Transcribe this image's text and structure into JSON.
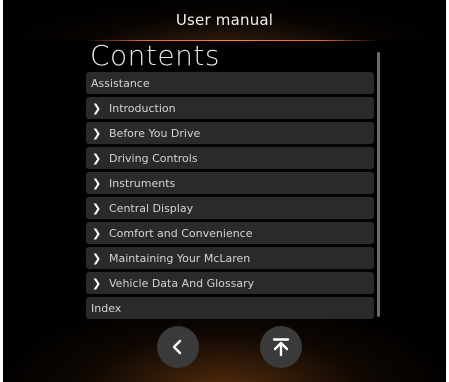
{
  "header": {
    "title": "User manual"
  },
  "contents": {
    "heading": "Contents",
    "items": [
      {
        "label": "Assistance",
        "expandable": false
      },
      {
        "label": "Introduction",
        "expandable": true
      },
      {
        "label": "Before You Drive",
        "expandable": true
      },
      {
        "label": "Driving Controls",
        "expandable": true
      },
      {
        "label": "Instruments",
        "expandable": true
      },
      {
        "label": "Central Display",
        "expandable": true
      },
      {
        "label": "Comfort and Convenience",
        "expandable": true
      },
      {
        "label": "Maintaining Your McLaren",
        "expandable": true
      },
      {
        "label": "Vehicle Data And Glossary",
        "expandable": true
      },
      {
        "label": "Index",
        "expandable": false
      }
    ]
  },
  "footer": {
    "back_icon": "chevron-left-icon",
    "top_icon": "scroll-to-top-icon"
  },
  "colors": {
    "background": "#000000",
    "row_background": "#2a2a2a",
    "accent_rule": "#ff8040",
    "button_background": "#3a3a3a",
    "text": "#d4d4d4"
  }
}
